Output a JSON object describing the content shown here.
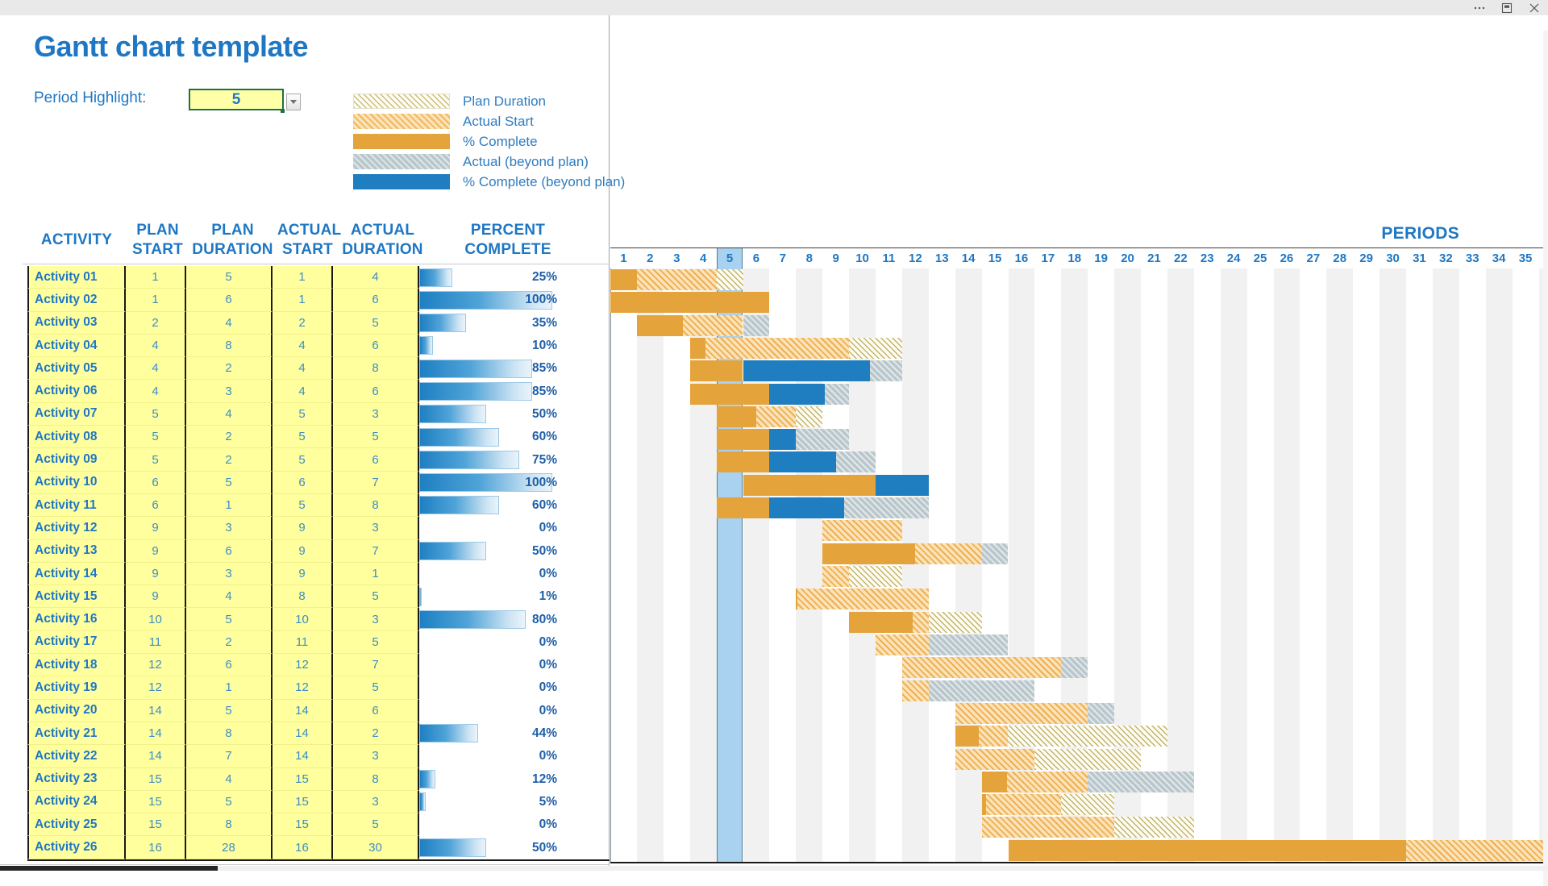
{
  "window": {
    "buttons": [
      {
        "name": "more-options",
        "label": "..."
      },
      {
        "name": "restore-window",
        "label": "Restore"
      },
      {
        "name": "close-window",
        "label": "Close"
      }
    ]
  },
  "header": {
    "title": "Gantt chart template",
    "period_highlight_label": "Period Highlight:",
    "period_highlight_value": "5",
    "periods_title": "PERIODS"
  },
  "legend": [
    {
      "key": "plan",
      "label": "Plan Duration",
      "swatch": "sw-plan",
      "color": "#fdfdf7"
    },
    {
      "key": "actual",
      "label": "Actual Start",
      "swatch": "sw-actual",
      "color": "#fbe2b9"
    },
    {
      "key": "pct",
      "label": "% Complete",
      "swatch": "sw-pct",
      "color": "#e5a33c"
    },
    {
      "key": "beyond",
      "label": "Actual (beyond plan)",
      "swatch": "sw-beyond",
      "color": "#b9c7cc"
    },
    {
      "key": "pct_beyond",
      "label": "% Complete (beyond plan)",
      "swatch": "sw-pctbeyond",
      "color": "#1f7ec0"
    }
  ],
  "table": {
    "columns": [
      {
        "key": "activity",
        "label": "ACTIVITY"
      },
      {
        "key": "plan_start",
        "label": "PLAN START"
      },
      {
        "key": "plan_duration",
        "label": "PLAN DURATION"
      },
      {
        "key": "actual_start",
        "label": "ACTUAL START"
      },
      {
        "key": "actual_duration",
        "label": "ACTUAL DURATION"
      },
      {
        "key": "percent",
        "label": "PERCENT COMPLETE"
      }
    ],
    "rows": [
      {
        "activity": "Activity 01",
        "plan_start": 1,
        "plan_duration": 5,
        "actual_start": 1,
        "actual_duration": 4,
        "percent": 25,
        "percent_label": "25%"
      },
      {
        "activity": "Activity 02",
        "plan_start": 1,
        "plan_duration": 6,
        "actual_start": 1,
        "actual_duration": 6,
        "percent": 100,
        "percent_label": "100%"
      },
      {
        "activity": "Activity 03",
        "plan_start": 2,
        "plan_duration": 4,
        "actual_start": 2,
        "actual_duration": 5,
        "percent": 35,
        "percent_label": "35%"
      },
      {
        "activity": "Activity 04",
        "plan_start": 4,
        "plan_duration": 8,
        "actual_start": 4,
        "actual_duration": 6,
        "percent": 10,
        "percent_label": "10%"
      },
      {
        "activity": "Activity 05",
        "plan_start": 4,
        "plan_duration": 2,
        "actual_start": 4,
        "actual_duration": 8,
        "percent": 85,
        "percent_label": "85%"
      },
      {
        "activity": "Activity 06",
        "plan_start": 4,
        "plan_duration": 3,
        "actual_start": 4,
        "actual_duration": 6,
        "percent": 85,
        "percent_label": "85%"
      },
      {
        "activity": "Activity 07",
        "plan_start": 5,
        "plan_duration": 4,
        "actual_start": 5,
        "actual_duration": 3,
        "percent": 50,
        "percent_label": "50%"
      },
      {
        "activity": "Activity 08",
        "plan_start": 5,
        "plan_duration": 2,
        "actual_start": 5,
        "actual_duration": 5,
        "percent": 60,
        "percent_label": "60%"
      },
      {
        "activity": "Activity 09",
        "plan_start": 5,
        "plan_duration": 2,
        "actual_start": 5,
        "actual_duration": 6,
        "percent": 75,
        "percent_label": "75%"
      },
      {
        "activity": "Activity 10",
        "plan_start": 6,
        "plan_duration": 5,
        "actual_start": 6,
        "actual_duration": 7,
        "percent": 100,
        "percent_label": "100%"
      },
      {
        "activity": "Activity 11",
        "plan_start": 6,
        "plan_duration": 1,
        "actual_start": 5,
        "actual_duration": 8,
        "percent": 60,
        "percent_label": "60%"
      },
      {
        "activity": "Activity 12",
        "plan_start": 9,
        "plan_duration": 3,
        "actual_start": 9,
        "actual_duration": 3,
        "percent": 0,
        "percent_label": "0%"
      },
      {
        "activity": "Activity 13",
        "plan_start": 9,
        "plan_duration": 6,
        "actual_start": 9,
        "actual_duration": 7,
        "percent": 50,
        "percent_label": "50%"
      },
      {
        "activity": "Activity 14",
        "plan_start": 9,
        "plan_duration": 3,
        "actual_start": 9,
        "actual_duration": 1,
        "percent": 0,
        "percent_label": "0%"
      },
      {
        "activity": "Activity 15",
        "plan_start": 9,
        "plan_duration": 4,
        "actual_start": 8,
        "actual_duration": 5,
        "percent": 1,
        "percent_label": "1%"
      },
      {
        "activity": "Activity 16",
        "plan_start": 10,
        "plan_duration": 5,
        "actual_start": 10,
        "actual_duration": 3,
        "percent": 80,
        "percent_label": "80%"
      },
      {
        "activity": "Activity 17",
        "plan_start": 11,
        "plan_duration": 2,
        "actual_start": 11,
        "actual_duration": 5,
        "percent": 0,
        "percent_label": "0%"
      },
      {
        "activity": "Activity 18",
        "plan_start": 12,
        "plan_duration": 6,
        "actual_start": 12,
        "actual_duration": 7,
        "percent": 0,
        "percent_label": "0%"
      },
      {
        "activity": "Activity 19",
        "plan_start": 12,
        "plan_duration": 1,
        "actual_start": 12,
        "actual_duration": 5,
        "percent": 0,
        "percent_label": "0%"
      },
      {
        "activity": "Activity 20",
        "plan_start": 14,
        "plan_duration": 5,
        "actual_start": 14,
        "actual_duration": 6,
        "percent": 0,
        "percent_label": "0%"
      },
      {
        "activity": "Activity 21",
        "plan_start": 14,
        "plan_duration": 8,
        "actual_start": 14,
        "actual_duration": 2,
        "percent": 44,
        "percent_label": "44%"
      },
      {
        "activity": "Activity 22",
        "plan_start": 14,
        "plan_duration": 7,
        "actual_start": 14,
        "actual_duration": 3,
        "percent": 0,
        "percent_label": "0%"
      },
      {
        "activity": "Activity 23",
        "plan_start": 15,
        "plan_duration": 4,
        "actual_start": 15,
        "actual_duration": 8,
        "percent": 12,
        "percent_label": "12%"
      },
      {
        "activity": "Activity 24",
        "plan_start": 15,
        "plan_duration": 5,
        "actual_start": 15,
        "actual_duration": 3,
        "percent": 5,
        "percent_label": "5%"
      },
      {
        "activity": "Activity 25",
        "plan_start": 15,
        "plan_duration": 8,
        "actual_start": 15,
        "actual_duration": 5,
        "percent": 0,
        "percent_label": "0%"
      },
      {
        "activity": "Activity 26",
        "plan_start": 16,
        "plan_duration": 28,
        "actual_start": 16,
        "actual_duration": 30,
        "percent": 50,
        "percent_label": "50%"
      }
    ]
  },
  "chart_data": {
    "type": "bar",
    "title": "Gantt chart template",
    "xlabel": "PERIODS",
    "ylabel": "ACTIVITY",
    "grid": true,
    "legend_position": "top",
    "highlight_period": 5,
    "period_ticks": [
      1,
      2,
      3,
      4,
      5,
      6,
      7,
      8,
      9,
      10,
      11,
      12,
      13,
      14,
      15,
      16,
      17,
      18,
      19,
      20,
      21,
      22,
      23,
      24,
      25,
      26,
      27,
      28,
      29,
      30,
      31,
      32,
      33,
      34,
      35
    ],
    "xlim": [
      1,
      36
    ],
    "categories": [
      "Activity 01",
      "Activity 02",
      "Activity 03",
      "Activity 04",
      "Activity 05",
      "Activity 06",
      "Activity 07",
      "Activity 08",
      "Activity 09",
      "Activity 10",
      "Activity 11",
      "Activity 12",
      "Activity 13",
      "Activity 14",
      "Activity 15",
      "Activity 16",
      "Activity 17",
      "Activity 18",
      "Activity 19",
      "Activity 20",
      "Activity 21",
      "Activity 22",
      "Activity 23",
      "Activity 24",
      "Activity 25",
      "Activity 26"
    ],
    "series": [
      {
        "name": "Plan Start",
        "values": [
          1,
          1,
          2,
          4,
          4,
          4,
          5,
          5,
          5,
          6,
          6,
          9,
          9,
          9,
          9,
          10,
          11,
          12,
          12,
          14,
          14,
          14,
          15,
          15,
          15,
          16
        ]
      },
      {
        "name": "Plan Duration",
        "values": [
          5,
          6,
          4,
          8,
          2,
          3,
          4,
          2,
          2,
          5,
          1,
          3,
          6,
          3,
          4,
          5,
          2,
          6,
          1,
          5,
          8,
          7,
          4,
          5,
          8,
          28
        ]
      },
      {
        "name": "Actual Start",
        "values": [
          1,
          1,
          2,
          4,
          4,
          4,
          5,
          5,
          5,
          6,
          5,
          9,
          9,
          9,
          8,
          10,
          11,
          12,
          12,
          14,
          14,
          14,
          15,
          15,
          15,
          16
        ]
      },
      {
        "name": "Actual Duration",
        "values": [
          4,
          6,
          5,
          6,
          8,
          6,
          3,
          5,
          6,
          7,
          8,
          3,
          7,
          1,
          5,
          3,
          5,
          7,
          5,
          6,
          2,
          3,
          8,
          3,
          5,
          30
        ]
      },
      {
        "name": "Percent Complete",
        "values": [
          25,
          100,
          35,
          10,
          85,
          85,
          50,
          60,
          75,
          100,
          60,
          0,
          50,
          0,
          1,
          80,
          0,
          0,
          0,
          0,
          44,
          0,
          12,
          5,
          0,
          50
        ]
      }
    ]
  }
}
